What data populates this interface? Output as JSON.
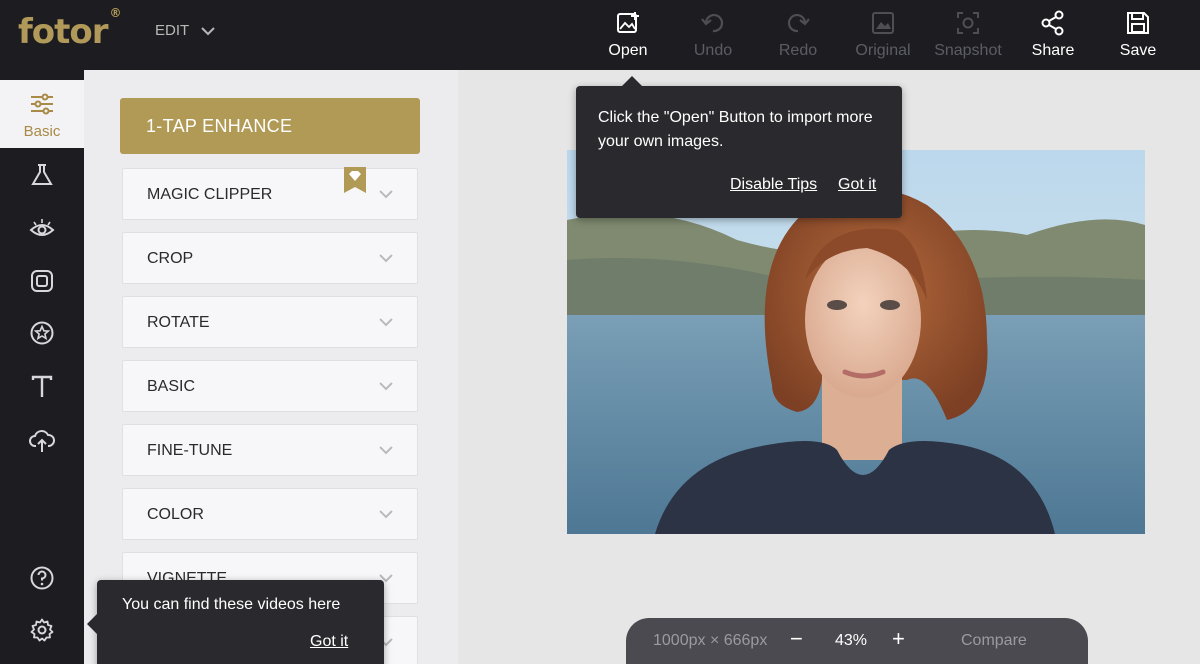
{
  "app": {
    "logo": "fotor",
    "logo_mark": "®",
    "menu_label": "EDIT"
  },
  "toolbar": {
    "open": "Open",
    "undo": "Undo",
    "redo": "Redo",
    "original": "Original",
    "snapshot": "Snapshot",
    "share": "Share",
    "save": "Save"
  },
  "rail": {
    "active_label": "Basic"
  },
  "panel": {
    "enhance_label": "1-TAP ENHANCE",
    "sections": [
      "MAGIC CLIPPER",
      "CROP",
      "ROTATE",
      "BASIC",
      "FINE-TUNE",
      "COLOR",
      "VIGNETTE"
    ]
  },
  "tip_open": {
    "message": "Click the \"Open\" Button to import more your own images.",
    "disable": "Disable Tips",
    "got_it": "Got it"
  },
  "tip_video": {
    "message": "You can find these videos here",
    "got_it": "Got it"
  },
  "zoom": {
    "dimensions": "1000px × 666px",
    "minus": "−",
    "percent": "43%",
    "plus": "+",
    "compare": "Compare"
  },
  "colors": {
    "accent": "#b19a55",
    "topbar": "#1d1d21",
    "panel": "#ececef",
    "canvas": "#e6e6e6"
  }
}
